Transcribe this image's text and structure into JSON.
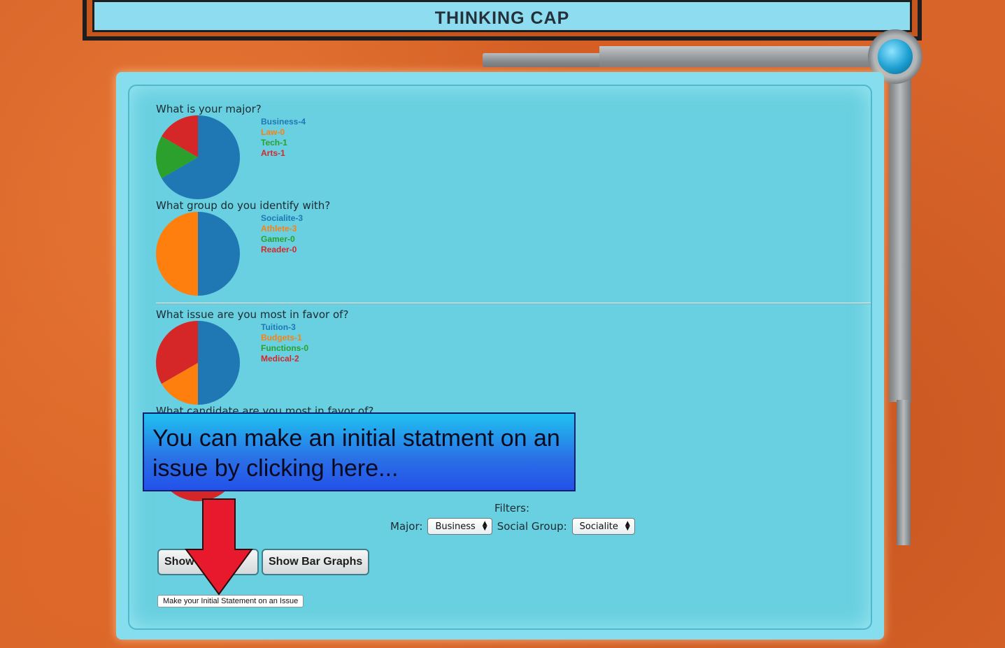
{
  "app": {
    "title": "THINKING CAP"
  },
  "questions": [
    {
      "text": "What is your major?",
      "options": [
        {
          "label": "Business-4",
          "count": 4,
          "color": "#1f77b4"
        },
        {
          "label": "Law-0",
          "count": 0,
          "color": "#ff7f0e"
        },
        {
          "label": "Tech-1",
          "count": 1,
          "color": "#2ca02c"
        },
        {
          "label": "Arts-1",
          "count": 1,
          "color": "#d62728"
        }
      ]
    },
    {
      "text": "What group do you identify with?",
      "options": [
        {
          "label": "Socialite-3",
          "count": 3,
          "color": "#1f77b4"
        },
        {
          "label": "Athlete-3",
          "count": 3,
          "color": "#ff7f0e"
        },
        {
          "label": "Gamer-0",
          "count": 0,
          "color": "#2ca02c"
        },
        {
          "label": "Reader-0",
          "count": 0,
          "color": "#d62728"
        }
      ]
    },
    {
      "text": "What issue are you most in favor of?",
      "options": [
        {
          "label": "Tuition-3",
          "count": 3,
          "color": "#1f77b4"
        },
        {
          "label": "Budgets-1",
          "count": 1,
          "color": "#ff7f0e"
        },
        {
          "label": "Functions-0",
          "count": 0,
          "color": "#2ca02c"
        },
        {
          "label": "Medical-2",
          "count": 2,
          "color": "#d62728"
        }
      ]
    },
    {
      "text": "What candidate are you most in favor of?"
    }
  ],
  "filters": {
    "title": "Filters:",
    "major_label": "Major:",
    "major_value": "Business",
    "social_label": "Social Group:",
    "social_value": "Socialite"
  },
  "buttons": {
    "show_data": "Show Data",
    "show_bar_graphs": "Show Bar Graphs",
    "initial_statement": "Make your Initial Statement on an Issue"
  },
  "tooltip": {
    "text": "You can make an initial statment on an issue by clicking here..."
  },
  "colors": {
    "arrow": "#e8192c",
    "tooltip_blue": "#2351ea"
  }
}
